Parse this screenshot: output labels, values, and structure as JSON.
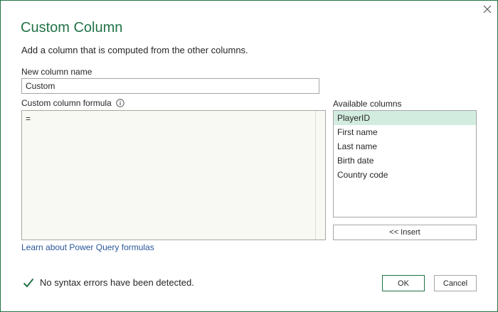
{
  "dialog": {
    "title": "Custom Column",
    "subtitle": "Add a column that is computed from the other columns.",
    "accent_color": "#217346",
    "close_icon": "close-icon"
  },
  "name_field": {
    "label": "New column name",
    "value": "Custom"
  },
  "formula": {
    "label": "Custom column formula",
    "info_icon": "info-icon",
    "value": "=",
    "learn_link": "Learn about Power Query formulas"
  },
  "available_columns": {
    "label": "Available columns",
    "items": [
      {
        "label": "PlayerID",
        "selected": true
      },
      {
        "label": "First name",
        "selected": false
      },
      {
        "label": "Last name",
        "selected": false
      },
      {
        "label": "Birth date",
        "selected": false
      },
      {
        "label": "Country code",
        "selected": false
      }
    ],
    "insert_label": "<< Insert"
  },
  "status": {
    "icon": "check-icon",
    "text": "No syntax errors have been detected.",
    "color": "#217346"
  },
  "buttons": {
    "ok_label": "OK",
    "cancel_label": "Cancel"
  }
}
